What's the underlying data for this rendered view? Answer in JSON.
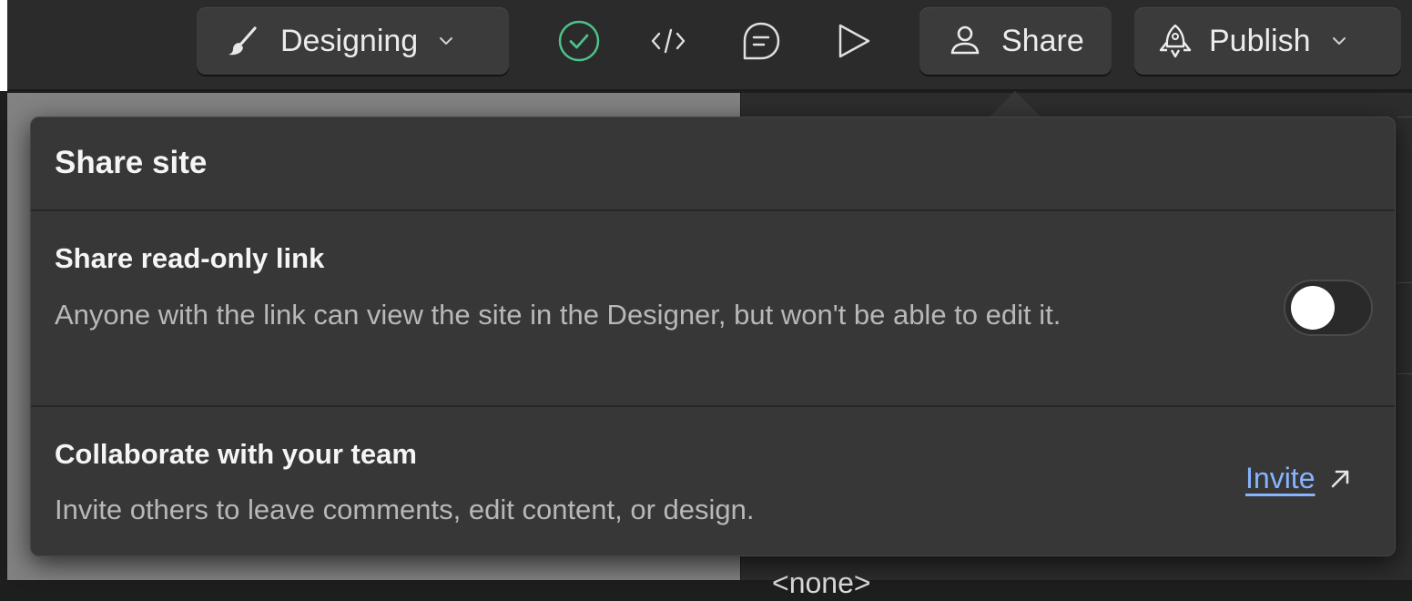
{
  "toolbar": {
    "mode_label": "Designing",
    "share_label": "Share",
    "publish_label": "Publish",
    "status_icon_color": "#4cc38a"
  },
  "icons": {
    "mode": "paintbrush-icon",
    "status": "check-circle-icon",
    "code": "code-icon",
    "comments": "comment-icon",
    "preview": "play-icon",
    "share": "user-icon",
    "publish": "rocket-icon",
    "invite": "external-arrow-icon"
  },
  "share_popover": {
    "title": "Share site",
    "read_only": {
      "title": "Share read-only link",
      "description": "Anyone with the link can view the site in the Designer, but won't be able to edit it.",
      "toggle_on": false
    },
    "collaborate": {
      "title": "Collaborate with your team",
      "description": "Invite others to leave comments, edit content, or design.",
      "link_label": "Invite"
    }
  },
  "panel": {
    "partial_text": "<none>"
  },
  "colors": {
    "accent_link": "#87b4ff",
    "popover_bg": "#373737",
    "toolbar_bg": "#2b2b2b"
  }
}
